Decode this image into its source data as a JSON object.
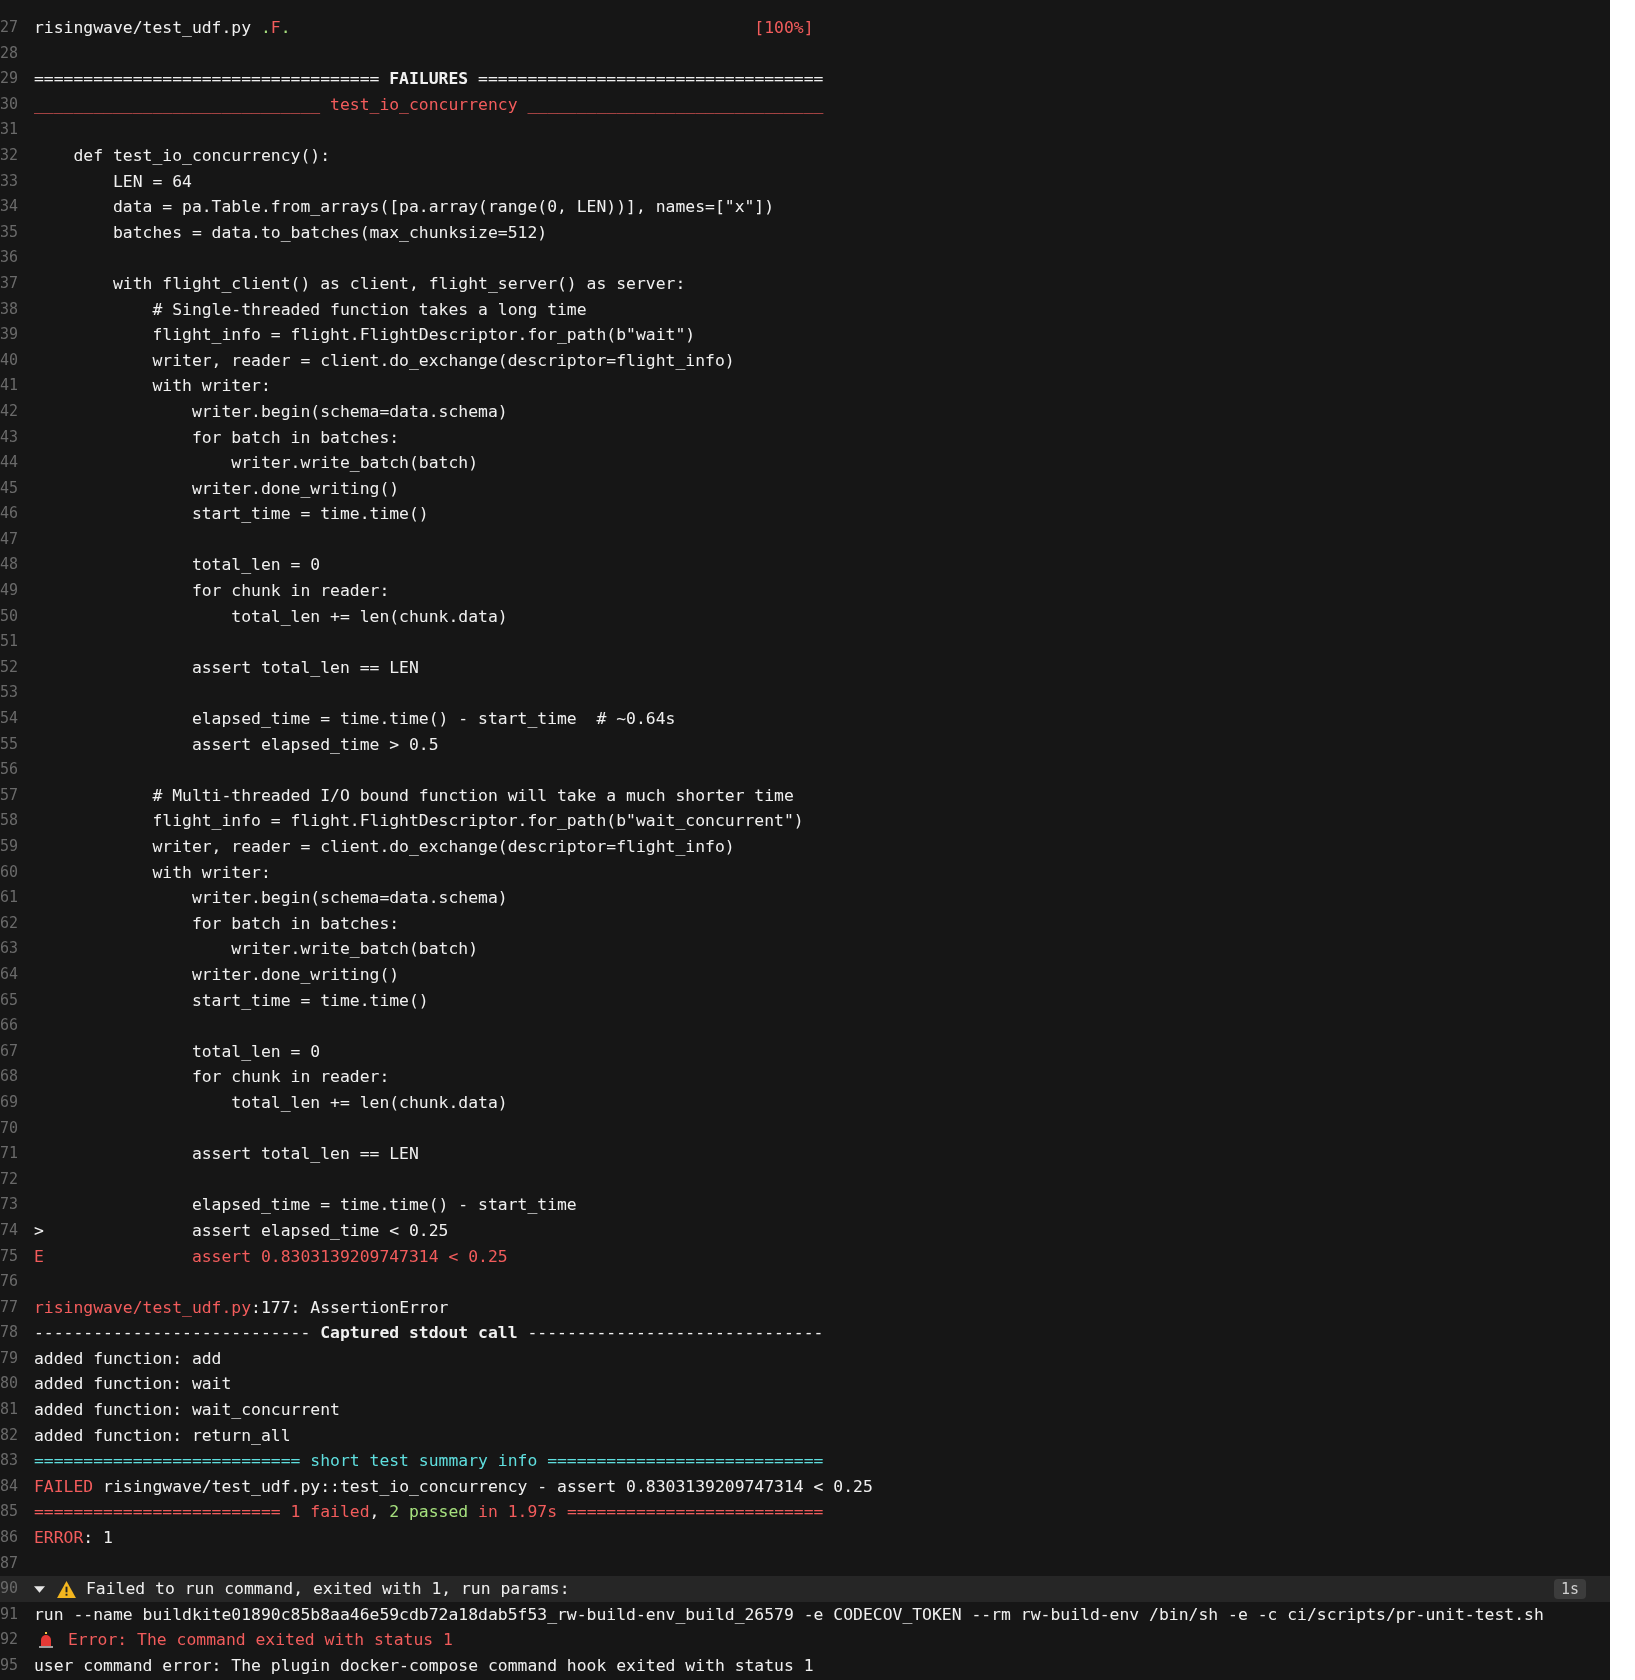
{
  "lines": [
    {
      "number": "27",
      "segments": [
        {
          "text": "risingwave/test_udf.py ",
          "kind": "plain"
        },
        {
          "text": ".",
          "kind": "pass"
        },
        {
          "text": "F",
          "kind": "fail"
        },
        {
          "text": ".",
          "kind": "pass"
        }
      ],
      "progress": "[100%]"
    },
    {
      "number": "28"
    },
    {
      "number": "29",
      "segments": [
        {
          "text": "=================================== ",
          "kind": "plain"
        },
        {
          "text": "FAILURES",
          "kind": "heading"
        },
        {
          "text": " ===================================",
          "kind": "plain"
        }
      ]
    },
    {
      "number": "30",
      "segments": [
        {
          "text": "_____________________________ test_io_concurrency ______________________________",
          "kind": "fail"
        }
      ]
    },
    {
      "number": "31"
    },
    {
      "number": "32",
      "text": "    def test_io_concurrency():"
    },
    {
      "number": "33",
      "text": "        LEN = 64"
    },
    {
      "number": "34",
      "text": "        data = pa.Table.from_arrays([pa.array(range(0, LEN))], names=[\"x\"])"
    },
    {
      "number": "35",
      "text": "        batches = data.to_batches(max_chunksize=512)"
    },
    {
      "number": "36"
    },
    {
      "number": "37",
      "text": "        with flight_client() as client, flight_server() as server:"
    },
    {
      "number": "38",
      "text": "            # Single-threaded function takes a long time"
    },
    {
      "number": "39",
      "text": "            flight_info = flight.FlightDescriptor.for_path(b\"wait\")"
    },
    {
      "number": "40",
      "text": "            writer, reader = client.do_exchange(descriptor=flight_info)"
    },
    {
      "number": "41",
      "text": "            with writer:"
    },
    {
      "number": "42",
      "text": "                writer.begin(schema=data.schema)"
    },
    {
      "number": "43",
      "text": "                for batch in batches:"
    },
    {
      "number": "44",
      "text": "                    writer.write_batch(batch)"
    },
    {
      "number": "45",
      "text": "                writer.done_writing()"
    },
    {
      "number": "46",
      "text": "                start_time = time.time()"
    },
    {
      "number": "47"
    },
    {
      "number": "48",
      "text": "                total_len = 0"
    },
    {
      "number": "49",
      "text": "                for chunk in reader:"
    },
    {
      "number": "50",
      "text": "                    total_len += len(chunk.data)"
    },
    {
      "number": "51"
    },
    {
      "number": "52",
      "text": "                assert total_len == LEN"
    },
    {
      "number": "53"
    },
    {
      "number": "54",
      "text": "                elapsed_time = time.time() - start_time  # ~0.64s"
    },
    {
      "number": "55",
      "text": "                assert elapsed_time > 0.5"
    },
    {
      "number": "56"
    },
    {
      "number": "57",
      "text": "            # Multi-threaded I/O bound function will take a much shorter time"
    },
    {
      "number": "58",
      "text": "            flight_info = flight.FlightDescriptor.for_path(b\"wait_concurrent\")"
    },
    {
      "number": "59",
      "text": "            writer, reader = client.do_exchange(descriptor=flight_info)"
    },
    {
      "number": "60",
      "text": "            with writer:"
    },
    {
      "number": "61",
      "text": "                writer.begin(schema=data.schema)"
    },
    {
      "number": "62",
      "text": "                for batch in batches:"
    },
    {
      "number": "63",
      "text": "                    writer.write_batch(batch)"
    },
    {
      "number": "64",
      "text": "                writer.done_writing()"
    },
    {
      "number": "65",
      "text": "                start_time = time.time()"
    },
    {
      "number": "66"
    },
    {
      "number": "67",
      "text": "                total_len = 0"
    },
    {
      "number": "68",
      "text": "                for chunk in reader:"
    },
    {
      "number": "69",
      "text": "                    total_len += len(chunk.data)"
    },
    {
      "number": "70"
    },
    {
      "number": "71",
      "text": "                assert total_len == LEN"
    },
    {
      "number": "72"
    },
    {
      "number": "73",
      "text": "                elapsed_time = time.time() - start_time"
    },
    {
      "number": "74",
      "text": ">               assert elapsed_time < 0.25"
    },
    {
      "number": "75",
      "segments": [
        {
          "text": "E               assert 0.8303139209747314 < 0.25",
          "kind": "fail"
        }
      ]
    },
    {
      "number": "76"
    },
    {
      "number": "77",
      "segments": [
        {
          "text": "risingwave/test_udf.py",
          "kind": "fail"
        },
        {
          "text": ":177: AssertionError",
          "kind": "plain"
        }
      ]
    },
    {
      "number": "78",
      "segments": [
        {
          "text": "---------------------------- ",
          "kind": "plain"
        },
        {
          "text": "Captured stdout call",
          "kind": "heading"
        },
        {
          "text": " ------------------------------",
          "kind": "plain"
        }
      ]
    },
    {
      "number": "79",
      "text": "added function: add"
    },
    {
      "number": "80",
      "text": "added function: wait"
    },
    {
      "number": "81",
      "text": "added function: wait_concurrent"
    },
    {
      "number": "82",
      "text": "added function: return_all"
    },
    {
      "number": "83",
      "segments": [
        {
          "text": "=========================== short test summary info ============================",
          "kind": "info"
        }
      ]
    },
    {
      "number": "84",
      "segments": [
        {
          "text": "FAILED",
          "kind": "fail"
        },
        {
          "text": " risingwave/test_udf.py::test_io_concurrency - assert 0.8303139209747314 < 0.25",
          "kind": "plain"
        }
      ]
    },
    {
      "number": "85",
      "segments": [
        {
          "text": "========================= 1 failed",
          "kind": "fail"
        },
        {
          "text": ", ",
          "kind": "plain"
        },
        {
          "text": "2 passed",
          "kind": "pass"
        },
        {
          "text": " in 1.97s ==========================",
          "kind": "fail"
        }
      ]
    },
    {
      "number": "86",
      "segments": [
        {
          "text": "ERROR",
          "kind": "fail"
        },
        {
          "text": ": 1",
          "kind": "plain"
        }
      ]
    },
    {
      "number": "87"
    },
    {
      "number": "90",
      "kind": "group",
      "expanded": true,
      "text": "Failed to run command, exited with 1, run params:",
      "duration": "1s"
    },
    {
      "number": "91",
      "text": "run --name buildkite01890c85b8aa46e59cdb72a18dab5f53_rw-build-env_build_26579 -e CODECOV_TOKEN --rm rw-build-env /bin/sh -e -c ci/scripts/pr-unit-test.sh"
    },
    {
      "number": "92",
      "kind": "error",
      "text": "Error: The command exited with status 1"
    },
    {
      "number": "95",
      "text": "user command error: The plugin docker-compose command hook exited with status 1"
    }
  ]
}
